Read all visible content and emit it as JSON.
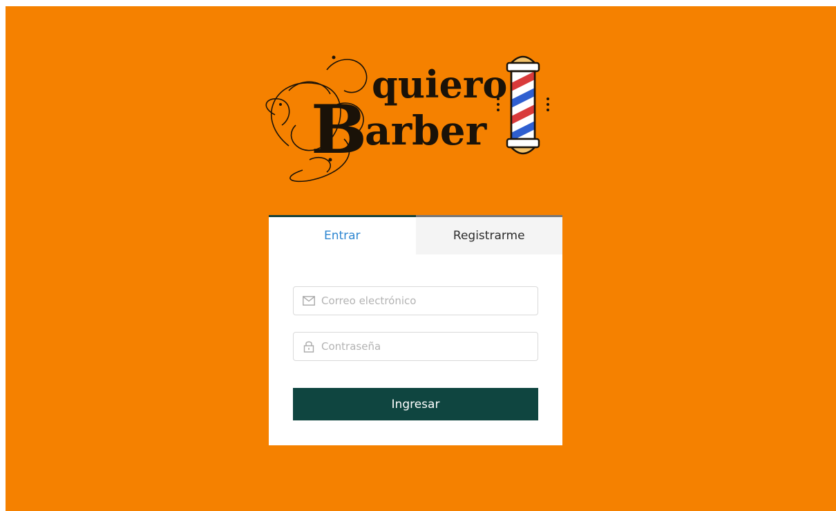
{
  "brand": {
    "line1": "quiero",
    "initial": "B",
    "line2": "arber"
  },
  "tabs": [
    {
      "label": "Entrar",
      "active": true
    },
    {
      "label": "Registrarme",
      "active": false
    }
  ],
  "form": {
    "email": {
      "placeholder": "Correo electrónico",
      "value": "",
      "icon": "mail-icon"
    },
    "password": {
      "placeholder": "Contraseña",
      "value": "",
      "icon": "lock-icon"
    },
    "submit_label": "Ingresar"
  },
  "colors": {
    "background": "#f58100",
    "button": "#0f4540",
    "active_tab_text": "#2d86d1"
  }
}
